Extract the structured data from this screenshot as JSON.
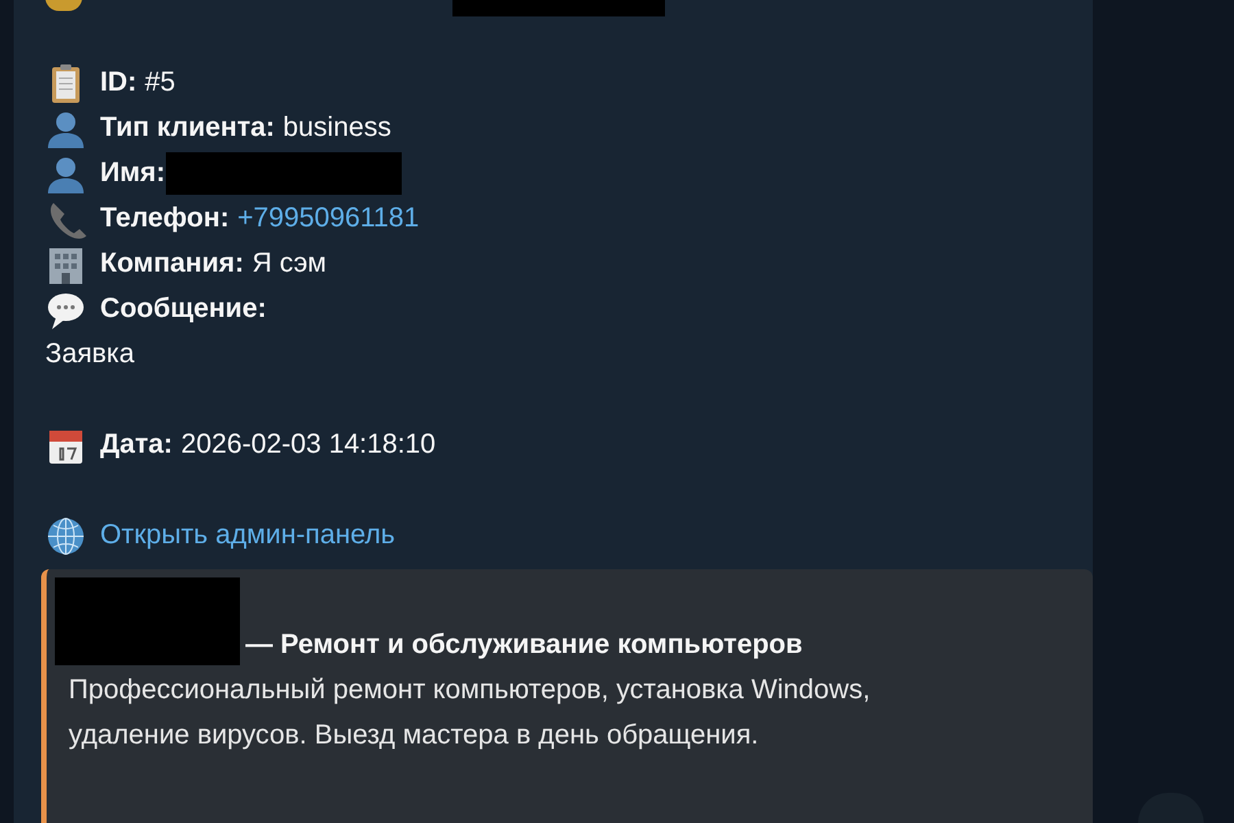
{
  "message": {
    "top_line": {
      "redacted": true
    },
    "fields": [
      {
        "kind": "id",
        "label": "ID:",
        "value": {
          "text": "#5"
        }
      },
      {
        "kind": "client_type",
        "label": "Тип клиента:",
        "value": {
          "text": "business"
        }
      },
      {
        "kind": "name",
        "label": "Имя:",
        "value": {
          "redacted": true
        }
      },
      {
        "kind": "phone",
        "label": "Телефон:",
        "value": {
          "text": "+79950961181",
          "link": true
        }
      },
      {
        "kind": "company",
        "label": "Компания:",
        "value": {
          "text": "Я сэм"
        }
      },
      {
        "kind": "message",
        "label": "Сообщение:"
      }
    ],
    "message_text": "Заявка",
    "date": {
      "label": "Дата:",
      "value": "2026-02-03 14:18:10"
    },
    "admin_link": "Открыть админ-панель",
    "preview": {
      "site_redacted": true,
      "title": "— Ремонт и обслуживание компьютеров",
      "description": "Профессиональный ремонт компьютеров, установка Windows, удаление вирусов. Выезд мастера в день обращения."
    }
  }
}
